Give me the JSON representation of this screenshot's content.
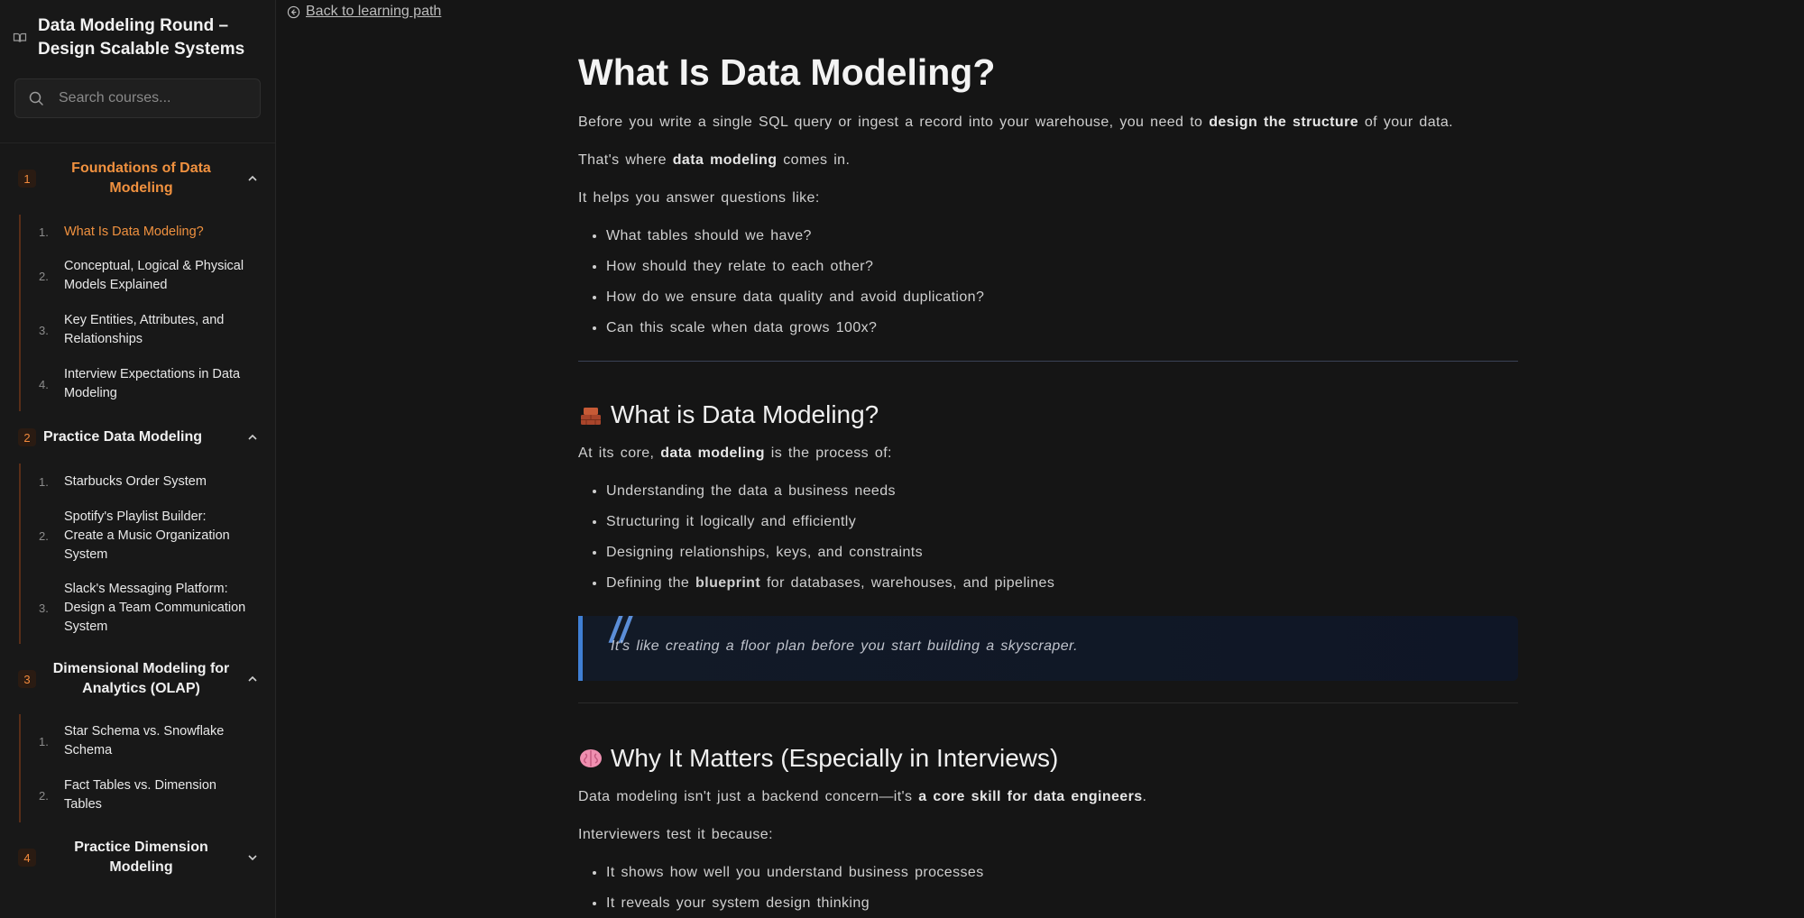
{
  "sidebar": {
    "title_line1": "Data Modeling Round –",
    "title_line2": "Design Scalable Systems",
    "search": {
      "placeholder": "Search courses..."
    },
    "modules": [
      {
        "number": "1",
        "title_lines": [
          "Foundations of Data",
          "Modeling"
        ],
        "expanded": true,
        "lessons": [
          {
            "number": "1.",
            "lines": [
              "What Is Data Modeling?"
            ],
            "active": true
          },
          {
            "number": "2.",
            "lines": [
              "Conceptual, Logical & Physical",
              "Models Explained"
            ]
          },
          {
            "number": "3.",
            "lines": [
              "Key Entities, Attributes, and",
              "Relationships"
            ]
          },
          {
            "number": "4.",
            "lines": [
              "Interview Expectations in Data",
              "Modeling"
            ]
          }
        ]
      },
      {
        "number": "2",
        "title_lines": [
          "Practice Data Modeling"
        ],
        "expanded": true,
        "lessons": [
          {
            "number": "1.",
            "lines": [
              "Starbucks Order System"
            ]
          },
          {
            "number": "2.",
            "lines": [
              "Spotify's Playlist Builder:",
              "Create a Music Organization",
              "System"
            ]
          },
          {
            "number": "3.",
            "lines": [
              "Slack's Messaging Platform:",
              "Design a Team Communication",
              "System"
            ]
          }
        ]
      },
      {
        "number": "3",
        "title_lines": [
          "Dimensional Modeling for",
          "Analytics (OLAP)"
        ],
        "expanded": true,
        "lessons": [
          {
            "number": "1.",
            "lines": [
              "Star Schema vs. Snowflake",
              "Schema"
            ]
          },
          {
            "number": "2.",
            "lines": [
              "Fact Tables vs. Dimension",
              "Tables"
            ]
          }
        ]
      },
      {
        "number": "4",
        "title_lines": [
          "Practice Dimension",
          "Modeling"
        ],
        "expanded": false,
        "lessons": []
      }
    ]
  },
  "back_link": "Back to learning path",
  "article": {
    "title": "What Is Data Modeling?",
    "intro": {
      "pre": "Before you write a single SQL query or ingest a record into your warehouse, you need to ",
      "bold": "design the structure",
      "post": " of your data."
    },
    "thats": {
      "pre": "That's where ",
      "bold": "data modeling",
      "post": " comes in."
    },
    "helps": "It helps you answer questions like:",
    "questions": [
      "What tables should we have?",
      "How should they relate to each other?",
      "How do we ensure data quality and avoid duplication?",
      "Can this scale when data grows 100x?"
    ],
    "section1": {
      "heading": "What is Data Modeling?",
      "core": {
        "pre": "At its core, ",
        "bold": "data modeling",
        "post": " is the process of:"
      },
      "items": [
        "Understanding the data a business needs",
        "Structuring it logically and efficiently",
        "Designing relationships, keys, and constraints"
      ],
      "last_item": {
        "pre": "Defining the ",
        "bold": "blueprint",
        "post": " for databases, warehouses, and pipelines"
      },
      "quote": "It's like creating a floor plan before you start building a skyscraper."
    },
    "section2": {
      "heading": "Why It Matters (Especially in Interviews)",
      "para": {
        "pre": "Data modeling isn't just a backend concern—it's ",
        "bold": "a core skill for data engineers",
        "post": "."
      },
      "test": "Interviewers test it because:",
      "items": [
        "It shows how well you understand business processes",
        "It reveals your system design thinking"
      ]
    }
  },
  "colors": {
    "accent": "#f0913f",
    "quote_border": "#3f7fd4",
    "background": "#151515"
  }
}
